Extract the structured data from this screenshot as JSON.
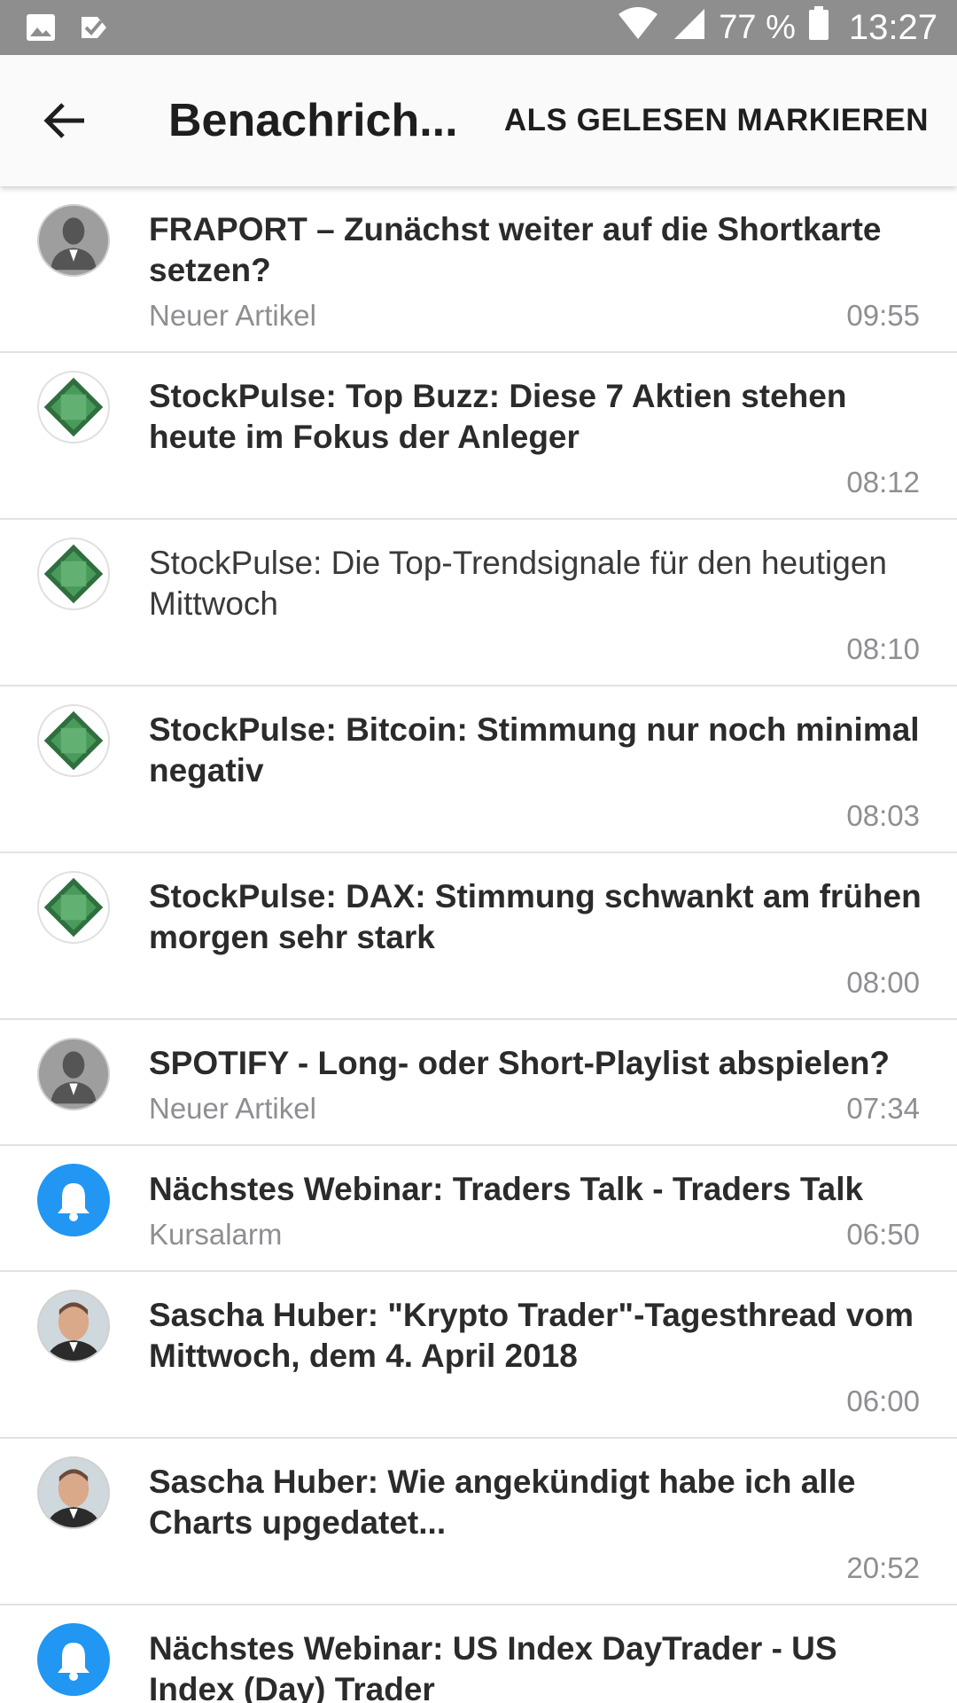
{
  "status_bar": {
    "battery": "77 %",
    "time": "13:27",
    "icons": [
      "image-icon",
      "check-notify-icon",
      "wifi-icon",
      "signal-icon",
      "battery-icon"
    ]
  },
  "app_bar": {
    "title": "Benachrich...",
    "action": "ALS GELESEN MARKIEREN"
  },
  "notifications": [
    {
      "avatar": "person-placeholder",
      "title": "FRAPORT – Zunächst weiter auf die Shortkarte setzen?",
      "subtitle": "Neuer Artikel",
      "time": "09:55",
      "bold": true
    },
    {
      "avatar": "stockpulse-logo",
      "title": "StockPulse: Top Buzz: Diese 7 Aktien stehen heute im Fokus der Anleger",
      "subtitle": "",
      "time": "08:12",
      "bold": true
    },
    {
      "avatar": "stockpulse-logo",
      "title": "StockPulse: Die Top-Trendsignale für den heutigen Mittwoch",
      "subtitle": "",
      "time": "08:10",
      "bold": false
    },
    {
      "avatar": "stockpulse-logo",
      "title": "StockPulse: Bitcoin: Stimmung nur noch minimal negativ",
      "subtitle": "",
      "time": "08:03",
      "bold": true
    },
    {
      "avatar": "stockpulse-logo",
      "title": "StockPulse: DAX: Stimmung schwankt am frühen morgen sehr stark",
      "subtitle": "",
      "time": "08:00",
      "bold": true
    },
    {
      "avatar": "person-placeholder",
      "title": "SPOTIFY - Long- oder Short-Playlist abspielen?",
      "subtitle": "Neuer Artikel",
      "time": "07:34",
      "bold": true
    },
    {
      "avatar": "bell",
      "title": "Nächstes Webinar: Traders Talk - Traders Talk",
      "subtitle": "Kursalarm",
      "time": "06:50",
      "bold": true
    },
    {
      "avatar": "user-photo",
      "title": "Sascha Huber: \"Krypto Trader\"-Tagesthread vom Mittwoch, dem 4. April 2018",
      "subtitle": "",
      "time": "06:00",
      "bold": true
    },
    {
      "avatar": "user-photo",
      "title": "Sascha Huber: Wie angekündigt habe ich alle Charts upgedatet...",
      "subtitle": "",
      "time": "20:52",
      "bold": true
    },
    {
      "avatar": "bell",
      "title": "Nächstes Webinar: US Index DayTrader - US Index (Day) Trader",
      "subtitle": "",
      "time": "",
      "bold": true
    }
  ],
  "colors": {
    "status_bar": "#8e8e8e",
    "bell_blue": "#2196f3",
    "stockpulse_green": "#3d8a50",
    "secondary_text": "#8e8e93"
  }
}
